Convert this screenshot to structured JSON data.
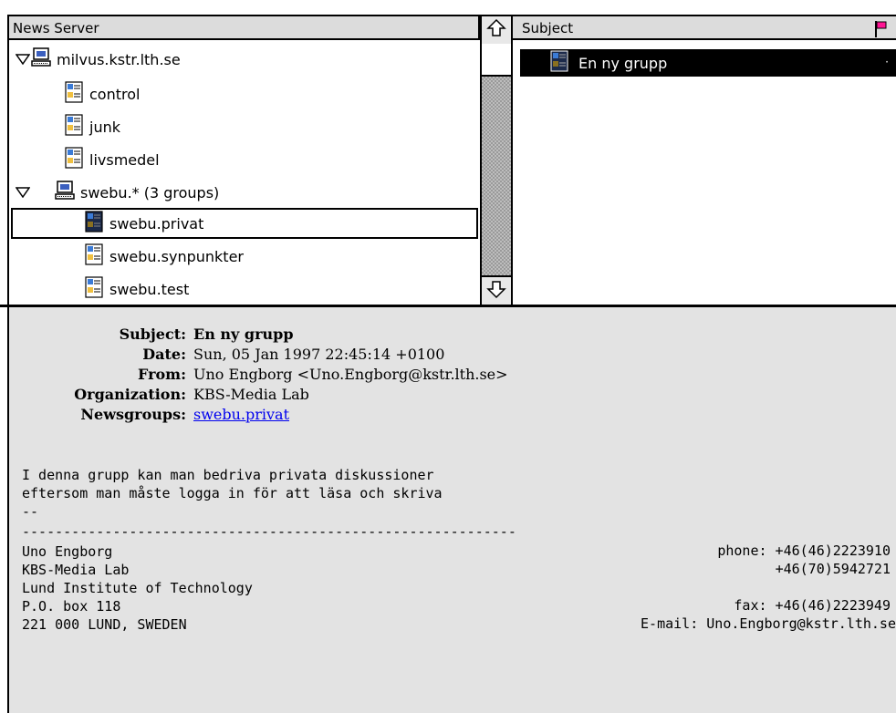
{
  "tree": {
    "header": "News Server",
    "items": [
      {
        "label": "milvus.kstr.lth.se",
        "kind": "server",
        "expanded": true
      },
      {
        "label": "control",
        "kind": "group"
      },
      {
        "label": "junk",
        "kind": "group"
      },
      {
        "label": "livsmedel",
        "kind": "group"
      },
      {
        "label": "swebu.* (3 groups)",
        "kind": "folder",
        "expanded": true
      },
      {
        "label": "swebu.privat",
        "kind": "group",
        "selected": true
      },
      {
        "label": "swebu.synpunkter",
        "kind": "group"
      },
      {
        "label": "swebu.test",
        "kind": "group"
      }
    ]
  },
  "subjects": {
    "header": "Subject",
    "items": [
      {
        "label": "En ny grupp",
        "selected": true,
        "marker": "·"
      }
    ]
  },
  "article": {
    "headers": [
      {
        "label": "Subject:",
        "value": "En ny grupp"
      },
      {
        "label": "Date:",
        "value": "Sun, 05 Jan 1997 22:45:14 +0100"
      },
      {
        "label": "From:",
        "value": "Uno Engborg <Uno.Engborg@kstr.lth.se>"
      },
      {
        "label": "Organization:",
        "value": "KBS-Media Lab"
      },
      {
        "label": "Newsgroups:",
        "value": "swebu.privat"
      }
    ],
    "body": [
      "I denna grupp kan man bedriva privata diskussioner",
      "eftersom man måste logga in för att läsa och skriva",
      "--",
      "------------------------------------------------------------"
    ],
    "signature_left": [
      "Uno Engborg",
      "KBS-Media Lab",
      "Lund Institute of Technology",
      "P.O. box 118",
      "221 000 LUND, SWEDEN"
    ],
    "signature_right": [
      "phone: +46(46)2223910",
      "+46(70)5942721",
      "",
      "fax: +46(46)2223949",
      "E-mail: Uno.Engborg@kstr.lth.se"
    ]
  },
  "colors": {
    "header_bg": "#dcdcdc",
    "article_bg": "#e3e3e3",
    "link": "#0000ee",
    "selection": "#000000",
    "flag": "#ff1493"
  },
  "icons": {
    "disclosure": "triangle-down-icon",
    "server": "computer-icon",
    "group": "newsgroup-icon",
    "scroll_up": "arrow-up-icon",
    "scroll_down": "arrow-down-icon",
    "flag": "flag-icon"
  }
}
